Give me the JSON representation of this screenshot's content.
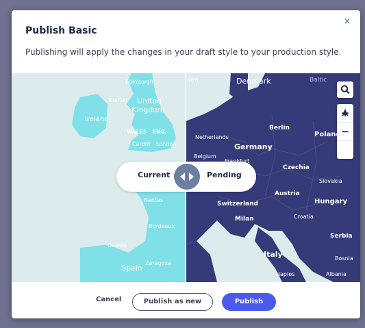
{
  "dialog": {
    "title": "Publish Basic",
    "subtitle": "Publishing will apply the changes in your draft style to your production style.",
    "close_symbol": "×"
  },
  "compare": {
    "current_label": "Current",
    "pending_label": "Pending"
  },
  "map_controls": {
    "search_icon": "search-icon",
    "zoom_in": "+",
    "zoom_out": "−",
    "compass": "▲"
  },
  "map_labels": {
    "left": [
      "Edinburgh",
      "Belfast",
      "United",
      "Kingdom",
      "Ireland",
      "WALES",
      "ENG.",
      "Cardiff",
      "London",
      "Nantes",
      "Bordeaux",
      "Oviedo",
      "Spain",
      "Zaragoza",
      "Sea"
    ],
    "right": [
      "Denmark",
      "Baltic",
      "Berlin",
      "Poland",
      "Netherlands",
      "Germany",
      "Belgium",
      "Frankfurt",
      "Czechia",
      "Slovakia",
      "Austria",
      "Hungary",
      "Switzerland",
      "Milan",
      "Croatia",
      "Serbia",
      "Italy",
      "Naples",
      "Albania",
      "Bosnia"
    ]
  },
  "footer": {
    "cancel": "Cancel",
    "publish_as_new": "Publish as new",
    "publish": "Publish"
  },
  "colors": {
    "current_land": "#7fe0e8",
    "pending_land": "#353a78",
    "primary_button": "#4a5aef"
  }
}
